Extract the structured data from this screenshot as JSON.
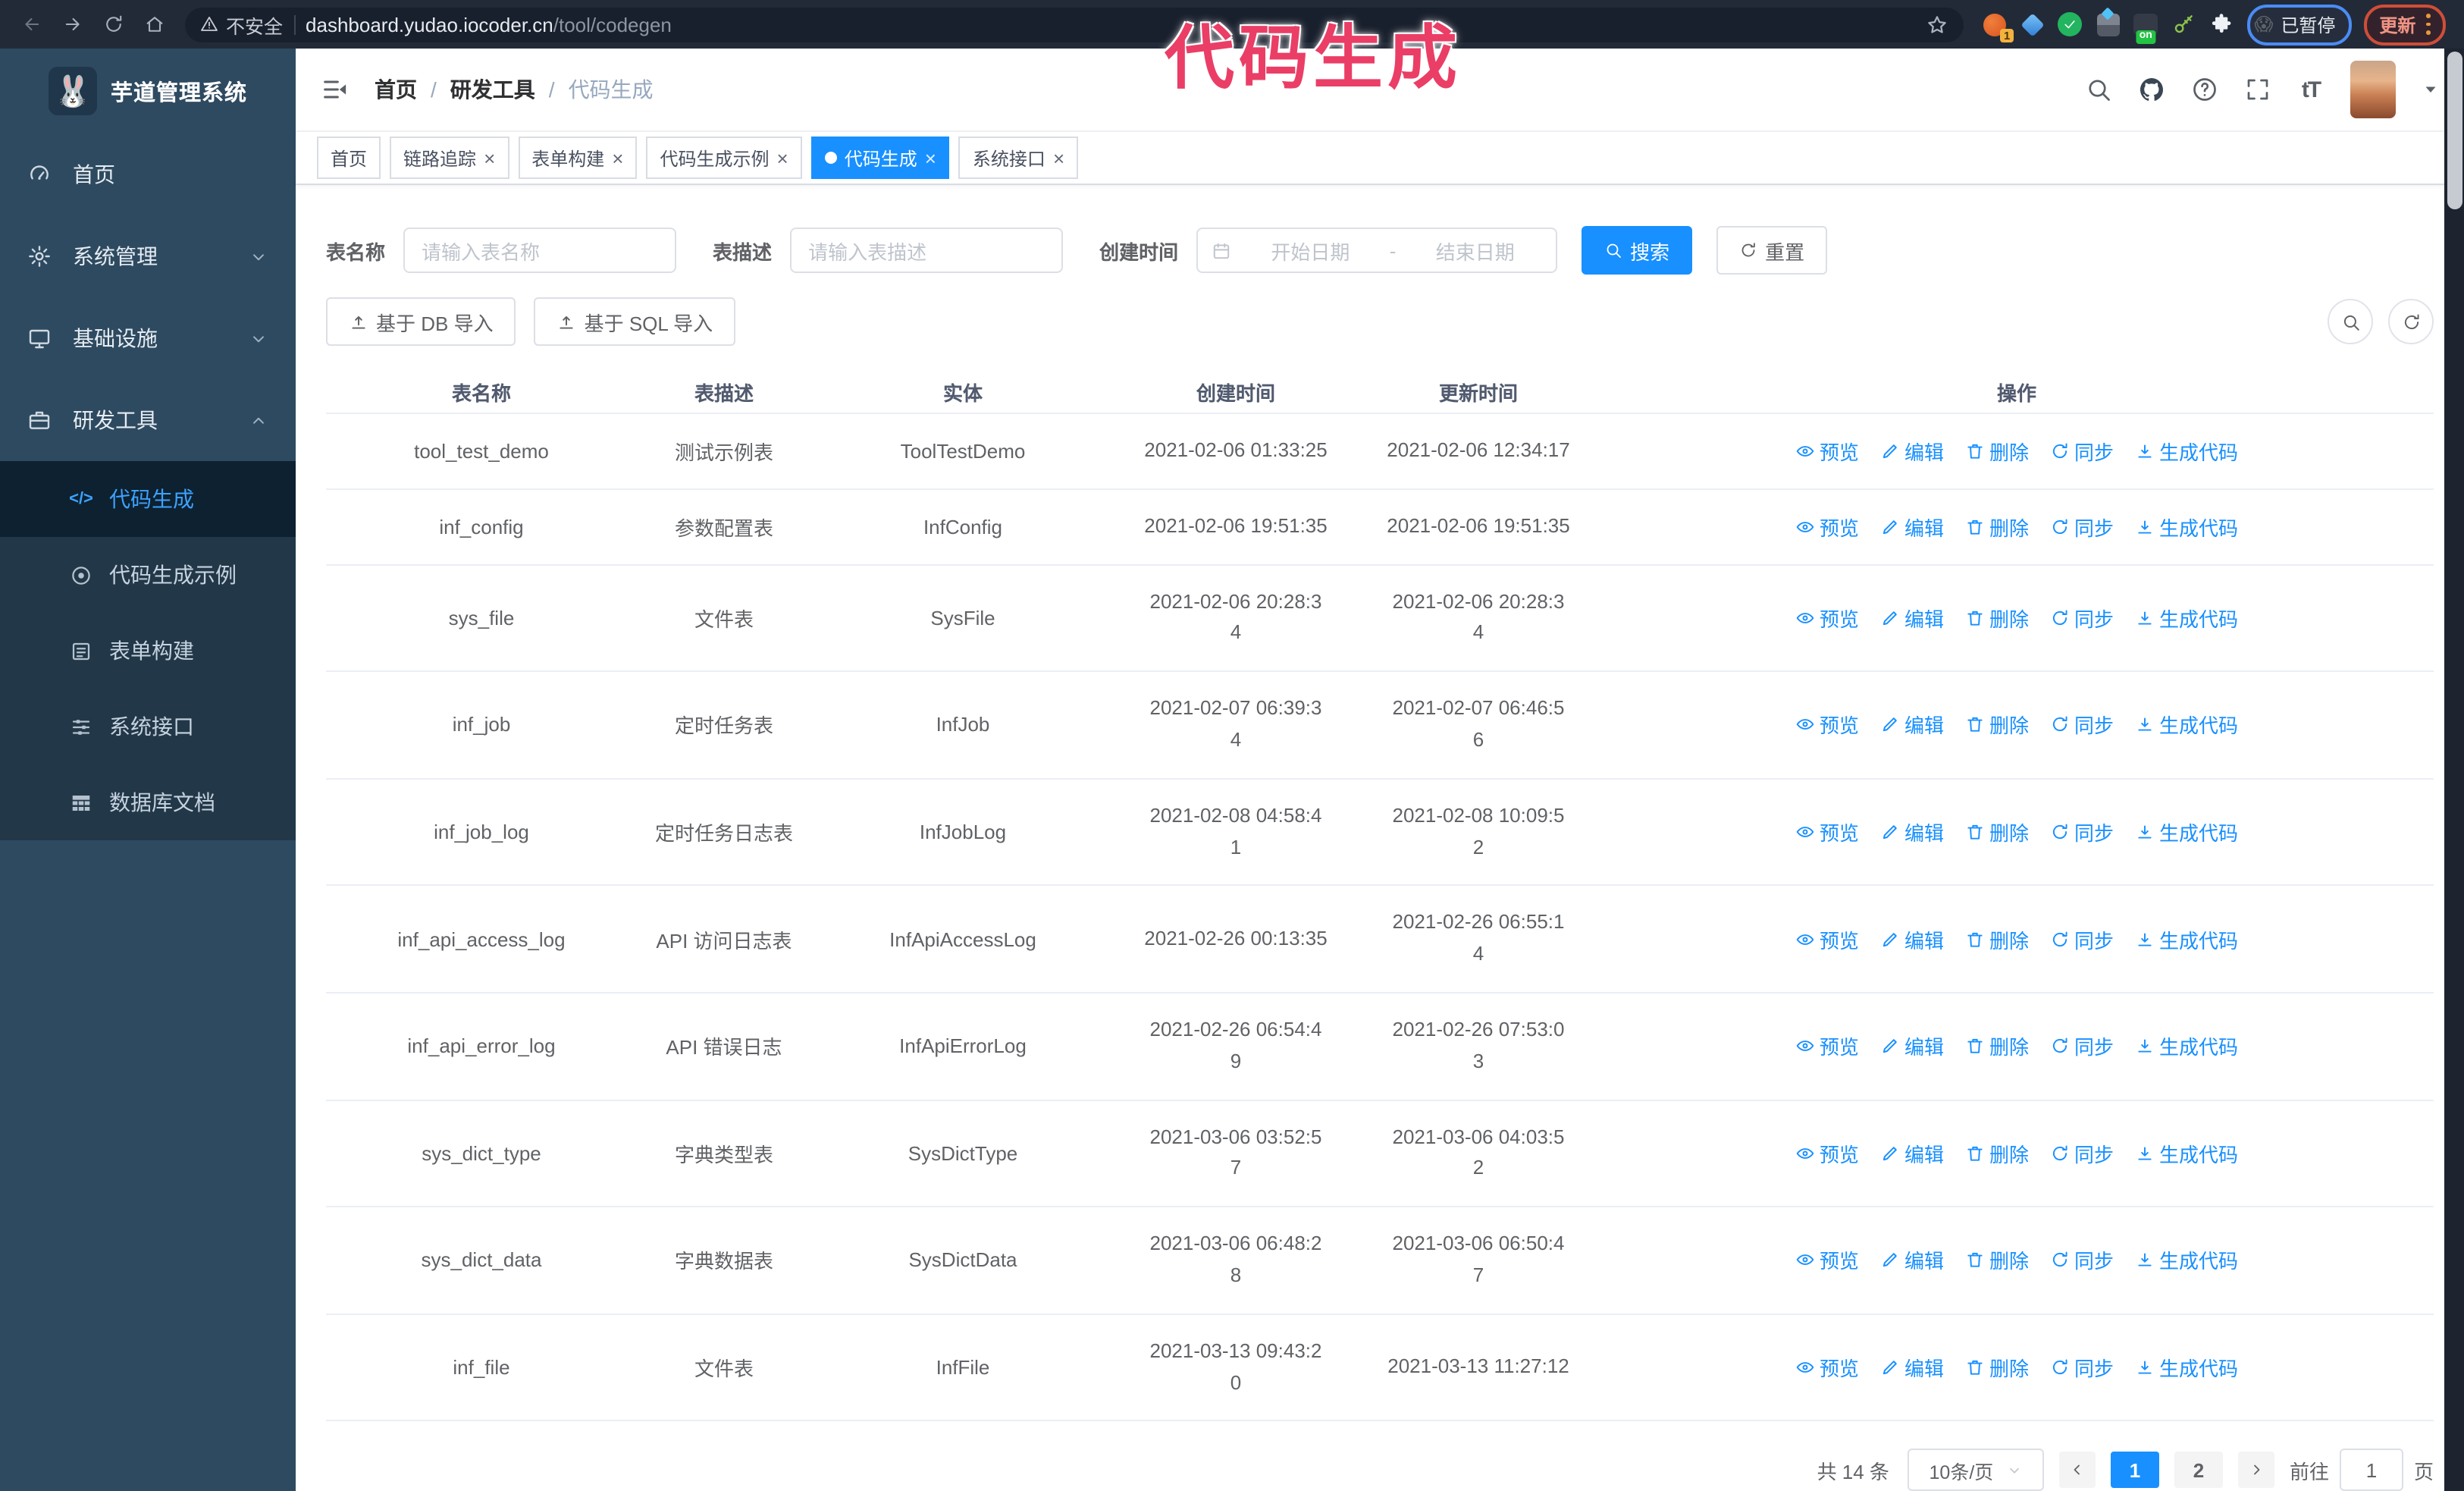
{
  "browser": {
    "insecure_label": "不安全",
    "url_host": "dashboard.yudao.iocoder.cn",
    "url_path": "/tool/codegen",
    "extension_badge": "1",
    "on_badge": "on",
    "paused_emoji": "😱",
    "paused_label": "已暂停",
    "update_label": "更新"
  },
  "overlay_title": "代码生成",
  "sidebar": {
    "logo_emoji": "🐰",
    "logo_text": "芋道管理系统",
    "items": [
      {
        "key": "home",
        "label": "首页",
        "icon": "gauge",
        "chevron": ""
      },
      {
        "key": "system",
        "label": "系统管理",
        "icon": "gear",
        "chevron": "chev-down"
      },
      {
        "key": "infra",
        "label": "基础设施",
        "icon": "monitor",
        "chevron": "chev-down"
      },
      {
        "key": "devtools",
        "label": "研发工具",
        "icon": "toolbox",
        "chevron": "chev-up"
      }
    ],
    "subitems": [
      {
        "key": "codegen",
        "label": "代码生成",
        "icon": "code",
        "active": true
      },
      {
        "key": "codegen-demo",
        "label": "代码生成示例",
        "icon": "eye-circle",
        "active": false
      },
      {
        "key": "form-builder",
        "label": "表单构建",
        "icon": "form",
        "active": false
      },
      {
        "key": "system-api",
        "label": "系统接口",
        "icon": "sliders",
        "active": false
      },
      {
        "key": "db-doc",
        "label": "数据库文档",
        "icon": "grid",
        "active": false
      }
    ]
  },
  "header": {
    "breadcrumb": [
      "首页",
      "研发工具",
      "代码生成"
    ],
    "breadcrumb_separator": "/"
  },
  "tabs": [
    {
      "key": "home",
      "label": "首页",
      "closable": false,
      "active": false
    },
    {
      "key": "tracing",
      "label": "链路追踪",
      "closable": true,
      "active": false
    },
    {
      "key": "form-builder",
      "label": "表单构建",
      "closable": true,
      "active": false
    },
    {
      "key": "codegen-demo",
      "label": "代码生成示例",
      "closable": true,
      "active": false
    },
    {
      "key": "codegen",
      "label": "代码生成",
      "closable": true,
      "active": true
    },
    {
      "key": "system-api",
      "label": "系统接口",
      "closable": true,
      "active": false
    }
  ],
  "filters": {
    "name_label": "表名称",
    "name_placeholder": "请输入表名称",
    "desc_label": "表描述",
    "desc_placeholder": "请输入表描述",
    "date_label": "创建时间",
    "date_start_placeholder": "开始日期",
    "date_separator": "-",
    "date_end_placeholder": "结束日期",
    "search_label": "搜索",
    "reset_label": "重置"
  },
  "toolbar": {
    "import_db_label": "基于 DB 导入",
    "import_sql_label": "基于 SQL 导入"
  },
  "table": {
    "columns": [
      "表名称",
      "表描述",
      "实体",
      "创建时间",
      "更新时间",
      "操作"
    ],
    "actions": [
      "预览",
      "编辑",
      "删除",
      "同步",
      "生成代码"
    ],
    "rows": [
      {
        "name": "tool_test_demo",
        "description": "测试示例表",
        "entity": "ToolTestDemo",
        "create_time": "2021-02-06 01:33:25",
        "update_time": "2021-02-06 12:34:17"
      },
      {
        "name": "inf_config",
        "description": "参数配置表",
        "entity": "InfConfig",
        "create_time": "2021-02-06 19:51:35",
        "update_time": "2021-02-06 19:51:35"
      },
      {
        "name": "sys_file",
        "description": "文件表",
        "entity": "SysFile",
        "create_time": "2021-02-06 20:28:3\n4",
        "update_time": "2021-02-06 20:28:3\n4"
      },
      {
        "name": "inf_job",
        "description": "定时任务表",
        "entity": "InfJob",
        "create_time": "2021-02-07 06:39:3\n4",
        "update_time": "2021-02-07 06:46:5\n6"
      },
      {
        "name": "inf_job_log",
        "description": "定时任务日志表",
        "entity": "InfJobLog",
        "create_time": "2021-02-08 04:58:4\n1",
        "update_time": "2021-02-08 10:09:5\n2"
      },
      {
        "name": "inf_api_access_log",
        "description": "API 访问日志表",
        "entity": "InfApiAccessLog",
        "create_time": "2021-02-26 00:13:35",
        "update_time": "2021-02-26 06:55:1\n4"
      },
      {
        "name": "inf_api_error_log",
        "description": "API 错误日志",
        "entity": "InfApiErrorLog",
        "create_time": "2021-02-26 06:54:4\n9",
        "update_time": "2021-02-26 07:53:0\n3"
      },
      {
        "name": "sys_dict_type",
        "description": "字典类型表",
        "entity": "SysDictType",
        "create_time": "2021-03-06 03:52:5\n7",
        "update_time": "2021-03-06 04:03:5\n2"
      },
      {
        "name": "sys_dict_data",
        "description": "字典数据表",
        "entity": "SysDictData",
        "create_time": "2021-03-06 06:48:2\n8",
        "update_time": "2021-03-06 06:50:4\n7"
      },
      {
        "name": "inf_file",
        "description": "文件表",
        "entity": "InfFile",
        "create_time": "2021-03-13 09:43:2\n0",
        "update_time": "2021-03-13 11:27:12"
      }
    ]
  },
  "pagination": {
    "total_text": "共 14 条",
    "page_size": "10条/页",
    "pages": [
      "1",
      "2"
    ],
    "active_page": "1",
    "goto_label": "前往",
    "goto_value": "1",
    "goto_suffix": "页"
  },
  "colors": {
    "primary": "#1890ff",
    "sidebar_bg": "#2e4a60",
    "submenu_bg": "#223849",
    "active_item_bg": "#0d2130",
    "overlay_pink": "#ea3e66"
  }
}
